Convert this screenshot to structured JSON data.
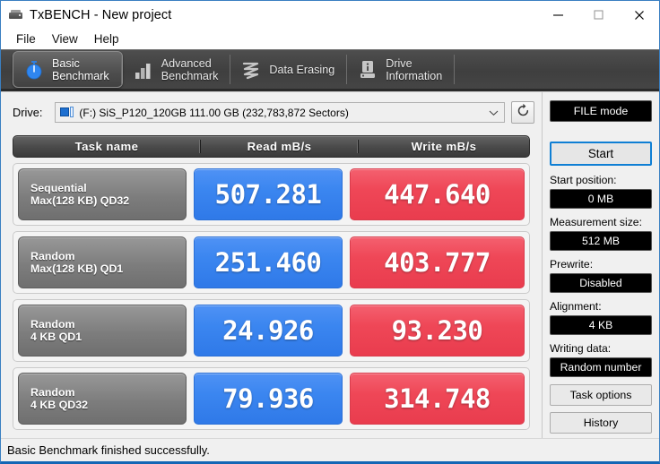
{
  "window": {
    "title": "TxBENCH - New project",
    "icon": "app-drive-icon",
    "minimize": "—",
    "maximize": "□",
    "close": "✕"
  },
  "menu": {
    "items": [
      {
        "label": "File"
      },
      {
        "label": "View"
      },
      {
        "label": "Help"
      }
    ]
  },
  "tabs": [
    {
      "label": "Basic\nBenchmark",
      "icon": "stopwatch-icon",
      "active": true
    },
    {
      "label": "Advanced\nBenchmark",
      "icon": "bar-chart-icon",
      "active": false
    },
    {
      "label": "Data Erasing",
      "icon": "shredder-icon",
      "active": false
    },
    {
      "label": "Drive\nInformation",
      "icon": "drive-info-icon",
      "active": false
    }
  ],
  "drive": {
    "label": "Drive:",
    "value": "(F:) SiS_P120_120GB  111.00 GB (232,783,872 Sectors)",
    "icon": "drive-glyph-icon",
    "dropdown_icon": "chevron-down-icon",
    "refresh_icon": "refresh-icon"
  },
  "table": {
    "headers": {
      "name": "Task name",
      "read": "Read mB/s",
      "write": "Write mB/s"
    },
    "rows": [
      {
        "name_line1": "Sequential",
        "name_line2": "Max(128 KB) QD32",
        "read": "507.281",
        "write": "447.640"
      },
      {
        "name_line1": "Random",
        "name_line2": "Max(128 KB) QD1",
        "read": "251.460",
        "write": "403.777"
      },
      {
        "name_line1": "Random",
        "name_line2": "4 KB QD1",
        "read": "24.926",
        "write": "93.230"
      },
      {
        "name_line1": "Random",
        "name_line2": "4 KB QD32",
        "read": "79.936",
        "write": "314.748"
      }
    ]
  },
  "sidebar": {
    "mode_badge": "FILE mode",
    "start_button": "Start",
    "fields": [
      {
        "label": "Start position:",
        "value": "0 MB"
      },
      {
        "label": "Measurement size:",
        "value": "512 MB"
      },
      {
        "label": "Prewrite:",
        "value": "Disabled"
      },
      {
        "label": "Alignment:",
        "value": "4 KB"
      },
      {
        "label": "Writing data:",
        "value": "Random number"
      }
    ],
    "buttons": [
      {
        "label": "Task options"
      },
      {
        "label": "History"
      }
    ]
  },
  "status": {
    "message": "Basic Benchmark finished successfully."
  },
  "colors": {
    "read_blue": "#3b86f0",
    "write_red": "#ef4757",
    "accent_blue": "#0f7fd4",
    "tabstrip": "#454545"
  }
}
